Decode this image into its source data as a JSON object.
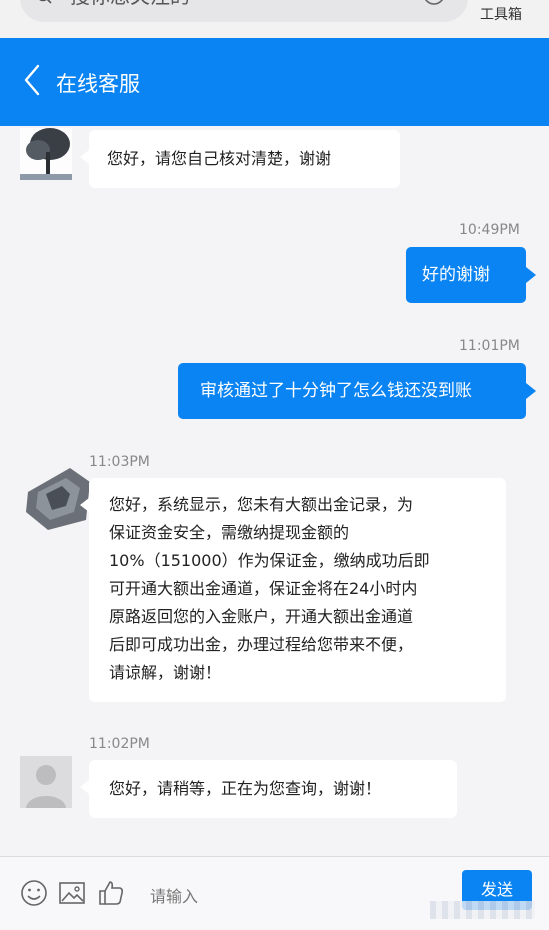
{
  "top": {
    "search_placeholder": "搜你想关注的",
    "toolbox_label": "工具箱"
  },
  "header": {
    "title": "在线客服"
  },
  "messages": [
    {
      "side": "left",
      "text": "您好，请您自己核对清楚，谢谢"
    },
    {
      "side": "right",
      "time": "10:49PM",
      "text": "好的谢谢"
    },
    {
      "side": "right",
      "time": "11:01PM",
      "text": "审核通过了十分钟了怎么钱还没到账"
    },
    {
      "side": "left",
      "time": "11:03PM",
      "lines": [
        "您好，系统显示，您未有大额出金记录，为",
        "保证资金安全，需缴纳提现金额的",
        "10%（151000）作为保证金，缴纳成功后即",
        "可开通大额出金通道，保证金将在24小时内",
        "原路返回您的入金账户，开通大额出金通道",
        "后即可成功出金，办理过程给您带来不便，",
        "请谅解，谢谢！"
      ]
    },
    {
      "side": "left",
      "time": "11:02PM",
      "text": "您好，请稍等，正在为您查询，谢谢！"
    }
  ],
  "input": {
    "placeholder": "请输入",
    "send_label": "发送"
  },
  "colors": {
    "accent": "#0a84f2",
    "background": "#f4f4f6"
  }
}
